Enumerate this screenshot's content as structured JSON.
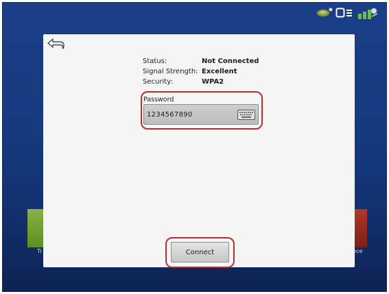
{
  "status_bar": {
    "icons": [
      "gps-signal-icon",
      "sync-icon",
      "gnss-satellite-icon"
    ]
  },
  "background_tiles": {
    "left_label": "Ti",
    "right_label": "nce"
  },
  "dialog": {
    "back_icon": "back-arrow-icon",
    "info": [
      {
        "label": "Status:",
        "value": "Not Connected"
      },
      {
        "label": "Signal Strength:",
        "value": "Excellent"
      },
      {
        "label": "Security:",
        "value": "WPA2"
      }
    ],
    "password": {
      "label": "Password",
      "value": "1234567890",
      "keyboard_icon": "keyboard-icon"
    },
    "connect_label": "Connect"
  },
  "colors": {
    "background": "#163a80",
    "dialog": "#f5f5f5",
    "highlight": "#c0292f"
  }
}
